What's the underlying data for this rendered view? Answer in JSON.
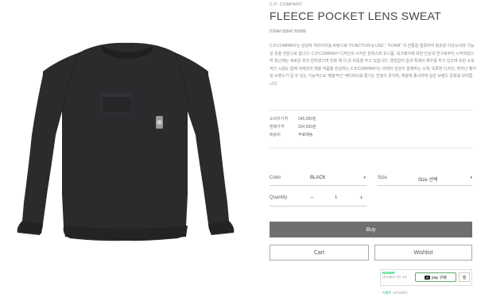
{
  "product": {
    "brand": "C.P. COMPANY",
    "title": "FLEECE POCKET LENS SWEAT",
    "item_no": "ITEM# 83947-50999",
    "description": "C.P.COMPANY는 상상력 캐리어지를 바탕으로 \"FUNCTION & USE\", \"FORM\" 의 전통을 접목하여 첨조된 아웃도어와 기능성 옷을 전문으로 합니다. C.P.COMPANY 디자인의 시작은 원피스와 유니폼, 워크웨어에 대한 인상과 연구로부터 시작되었으며 최근에는 새로운 위의 원하였으며 진화 해 더 큰 비중을 두고 있습니다. 끊임없이 일과 특제의 예우를 하고 있으며 또한 소모적인 시설도 함께 세계관의 예술 작품들 완성하는 C.P.COMPANY는 미래의 감성이 함께하는 소재, 독특한 디자인, 뛰어난 패키징 브랜드가 갈 수 있는 기능적으로 '예술적인' 액티비티를 즐기는 진정의 옷이며, 예술에 종사하며 깊은 브랜드 문화를 보여줍니다."
  },
  "prices": [
    {
      "label": "소비자가격",
      "value": "345,000원"
    },
    {
      "label": "판매가격",
      "value": "334,000원"
    },
    {
      "label": "배송비",
      "value": "무료배송"
    }
  ],
  "options": {
    "color_label": "Color",
    "color_value": "BLACK",
    "size_label": "Size",
    "size_value": "Size 선택",
    "quantity_label": "Quantity",
    "quantity_minus": "−",
    "quantity_value": "1",
    "quantity_plus": "+",
    "caret": "▾"
  },
  "buttons": {
    "buy": "Buy",
    "cart": "Cart",
    "wishlist": "Wishlist"
  },
  "npay": {
    "naver": "NAVER",
    "sub": "네이버페이 간편 주문",
    "badge": "N",
    "pay_label": "pay 구매",
    "wish_label": "찜",
    "footer_left": "이벤트",
    "footer_right": "네이버페이"
  }
}
